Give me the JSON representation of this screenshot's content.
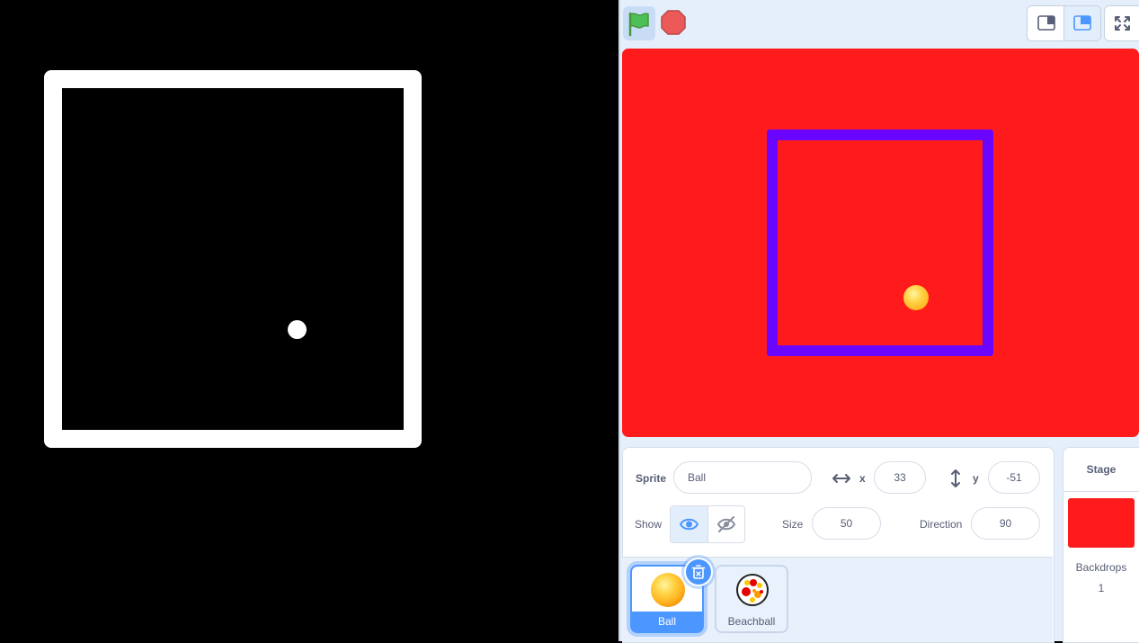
{
  "preview": {
    "background": "#000000",
    "foreground": "#ffffff"
  },
  "toolbar": {
    "green_flag_icon": "green-flag-icon",
    "stop_icon": "stop-sign-icon",
    "small_stage_icon": "small-stage-layout-icon",
    "normal_stage_icon": "normal-stage-layout-icon",
    "fullscreen_icon": "fullscreen-icon"
  },
  "stage": {
    "background": "#ff1b1b",
    "border_color": "#6a06ff"
  },
  "sprite_info": {
    "sprite_label": "Sprite",
    "sprite_name": "Ball",
    "x_label": "x",
    "x_value": "33",
    "y_label": "y",
    "y_value": "-51",
    "show_label": "Show",
    "size_label": "Size",
    "size_value": "50",
    "direction_label": "Direction",
    "direction_value": "90"
  },
  "sprites": [
    {
      "name": "Ball",
      "selected": true
    },
    {
      "name": "Beachball",
      "selected": false
    }
  ],
  "stage_pane": {
    "title": "Stage",
    "backdrops_label": "Backdrops",
    "backdrops_count": "1"
  },
  "colors": {
    "accent": "#4c97ff",
    "text": "#575e75",
    "gui_bg": "#e5effb"
  }
}
